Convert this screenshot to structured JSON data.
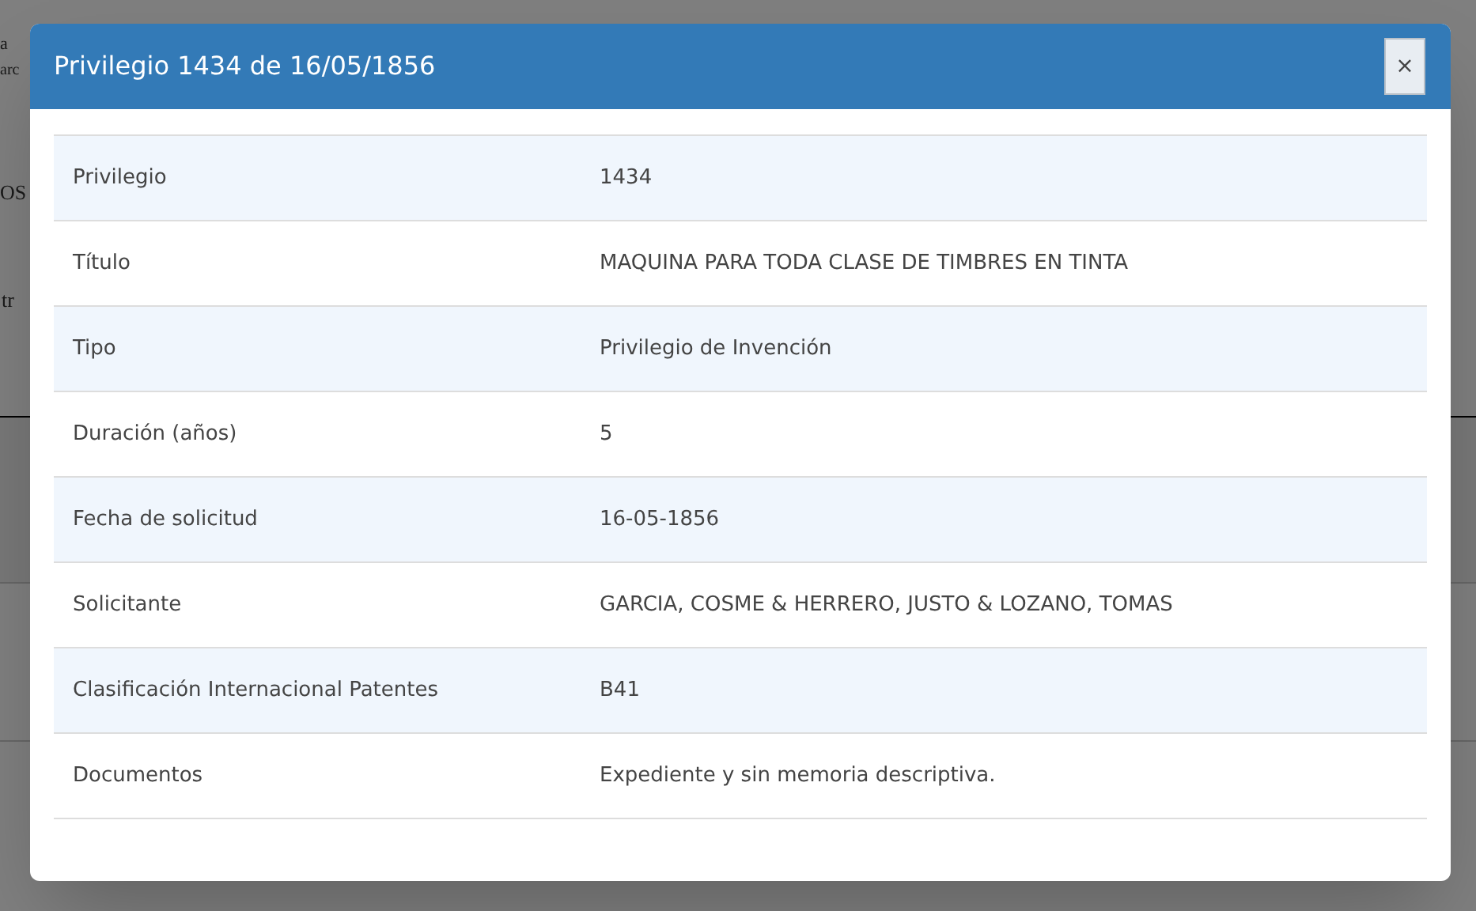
{
  "background": {
    "texts": [
      "a",
      "arc",
      "OS",
      "tr"
    ]
  },
  "modal": {
    "title": "Privilegio 1434 de 16/05/1856",
    "close": "×",
    "rows": [
      {
        "label": "Privilegio",
        "value": "1434"
      },
      {
        "label": "Título",
        "value": "MAQUINA PARA TODA CLASE DE TIMBRES EN TINTA"
      },
      {
        "label": "Tipo",
        "value": "Privilegio de Invención"
      },
      {
        "label": "Duración (años)",
        "value": "5"
      },
      {
        "label": "Fecha de solicitud",
        "value": "16-05-1856"
      },
      {
        "label": "Solicitante",
        "value": "GARCIA, COSME & HERRERO, JUSTO & LOZANO, TOMAS"
      },
      {
        "label": "Clasificación Internacional Patentes",
        "value": "B41"
      },
      {
        "label": "Documentos",
        "value": "Expediente y sin memoria descriptiva."
      }
    ]
  }
}
